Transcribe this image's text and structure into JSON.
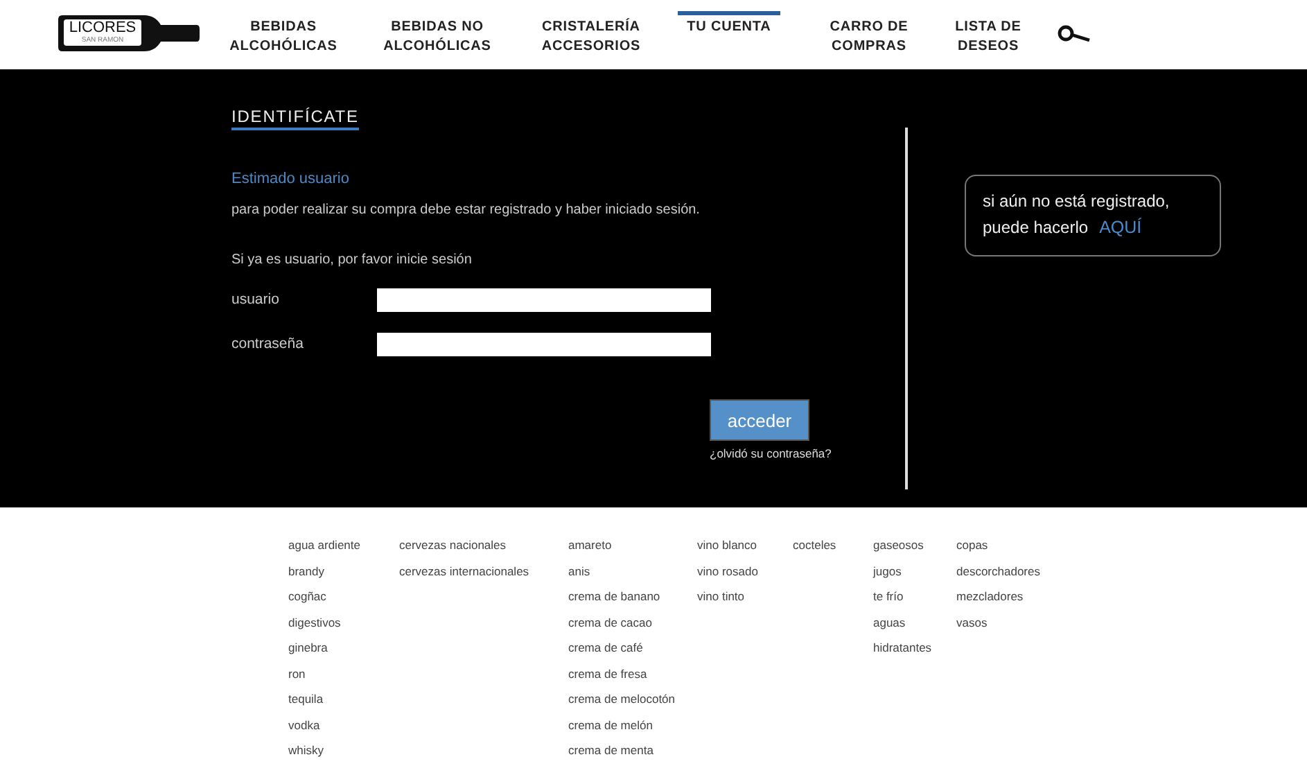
{
  "logo": {
    "name": "LICORES",
    "subtitle": "SAN RAMON"
  },
  "nav": [
    {
      "label": "BEBIDAS ALCOHÓLICAS",
      "selected": false
    },
    {
      "label": "BEBIDAS NO ALCOHÓLICAS",
      "selected": false
    },
    {
      "label": "CRISTALERÍA ACCESORIOS",
      "selected": false
    },
    {
      "label": "TU CUENTA",
      "selected": true
    },
    {
      "label": "CARRO DE COMPRAS",
      "selected": false
    },
    {
      "label": "LISTA DE DESEOS",
      "selected": false
    }
  ],
  "login": {
    "title": "IDENTIFÍCATE",
    "greeting": "Estimado usuario",
    "notice": "para poder realizar su compra debe estar registrado y haber iniciado sesión.",
    "prompt": "Si ya es usuario, por favor inicie sesión",
    "fields": [
      {
        "label": "usuario"
      },
      {
        "label": "contraseña"
      }
    ],
    "submit": "acceder",
    "forgot": "¿olvidó su contraseña?"
  },
  "register": {
    "text_line_1": "si aún no está registrado,",
    "text_line_2": "puede hacerlo",
    "link": "AQUÍ"
  },
  "footer_columns": [
    [
      "agua ardiente",
      "brandy",
      "cogñac",
      "digestivos",
      "ginebra",
      "ron",
      "tequila",
      "vodka",
      "whisky"
    ],
    [
      "cervezas nacionales",
      "cervezas internacionales"
    ],
    [
      "amareto",
      "anis",
      "crema de banano",
      "crema de cacao",
      "crema de café",
      "crema de fresa",
      "crema de melocotón",
      "crema de melón",
      "crema de menta"
    ],
    [
      "vino blanco",
      "vino rosado",
      "vino tinto"
    ],
    [
      "cocteles"
    ],
    [
      "gaseosos",
      "jugos",
      "te frío",
      "aguas",
      "hidratantes"
    ],
    [
      "copas",
      "descorchadores",
      "mezcladores",
      "vasos"
    ]
  ]
}
